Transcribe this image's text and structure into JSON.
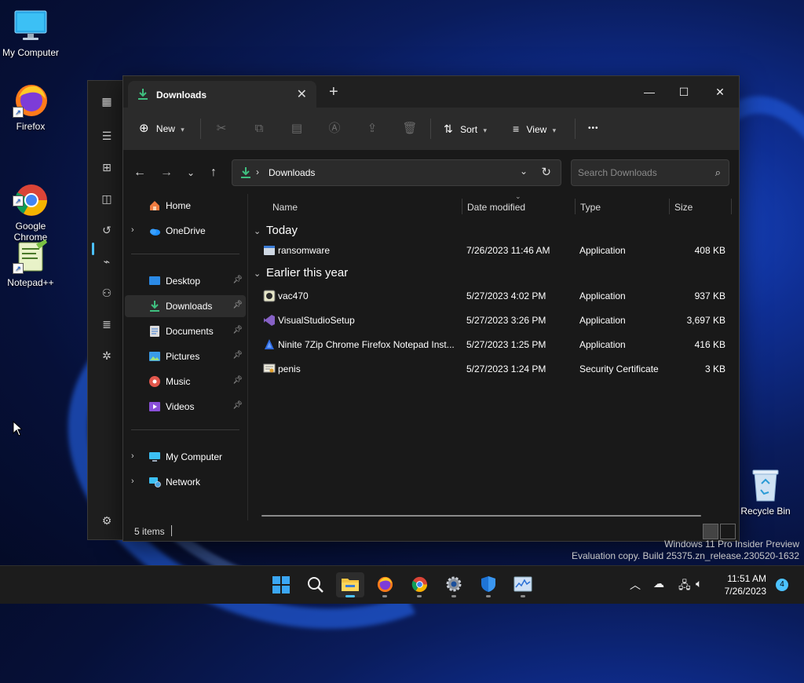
{
  "desktop": {
    "icons": [
      {
        "label": "My Computer"
      },
      {
        "label": "Firefox"
      },
      {
        "label": "Google\nChrome"
      },
      {
        "label": "Notepad++"
      }
    ],
    "recycle_bin": "Recycle Bin"
  },
  "explorer": {
    "tab_title": "Downloads",
    "toolbar": {
      "new_label": "New",
      "sort_label": "Sort",
      "view_label": "View",
      "more": "•••"
    },
    "address": {
      "path": "Downloads"
    },
    "search": {
      "placeholder": "Search Downloads"
    },
    "nav": [
      {
        "label": "Home"
      },
      {
        "label": "OneDrive"
      },
      {
        "label": "Desktop"
      },
      {
        "label": "Downloads"
      },
      {
        "label": "Documents"
      },
      {
        "label": "Pictures"
      },
      {
        "label": "Music"
      },
      {
        "label": "Videos"
      },
      {
        "label": "My Computer"
      },
      {
        "label": "Network"
      }
    ],
    "columns": [
      "Name",
      "Date modified",
      "Type",
      "Size"
    ],
    "groups": [
      {
        "label": "Today"
      },
      {
        "label": "Earlier this year"
      }
    ],
    "files": [
      {
        "name": "ransomware",
        "date": "7/26/2023 11:46 AM",
        "type": "Application",
        "size": "408 KB"
      },
      {
        "name": "vac470",
        "date": "5/27/2023 4:02 PM",
        "type": "Application",
        "size": "937 KB"
      },
      {
        "name": "VisualStudioSetup",
        "date": "5/27/2023 3:26 PM",
        "type": "Application",
        "size": "3,697 KB"
      },
      {
        "name": "Ninite 7Zip Chrome Firefox Notepad Inst...",
        "date": "5/27/2023 1:25 PM",
        "type": "Application",
        "size": "416 KB"
      },
      {
        "name": "penis",
        "date": "5/27/2023 1:24 PM",
        "type": "Security Certificate",
        "size": "3 KB"
      }
    ],
    "status": {
      "count": "5 items"
    }
  },
  "watermark": {
    "line1": "Windows 11 Pro Insider Preview",
    "line2": "Evaluation copy. Build 25375.zn_release.230520-1632"
  },
  "taskbar": {
    "time": "11:51 AM",
    "date": "7/26/2023",
    "notifications": "4"
  },
  "colors": {
    "accent": "#4cc2ff",
    "download_green": "#3fbf7f",
    "window_bg": "#191919"
  }
}
